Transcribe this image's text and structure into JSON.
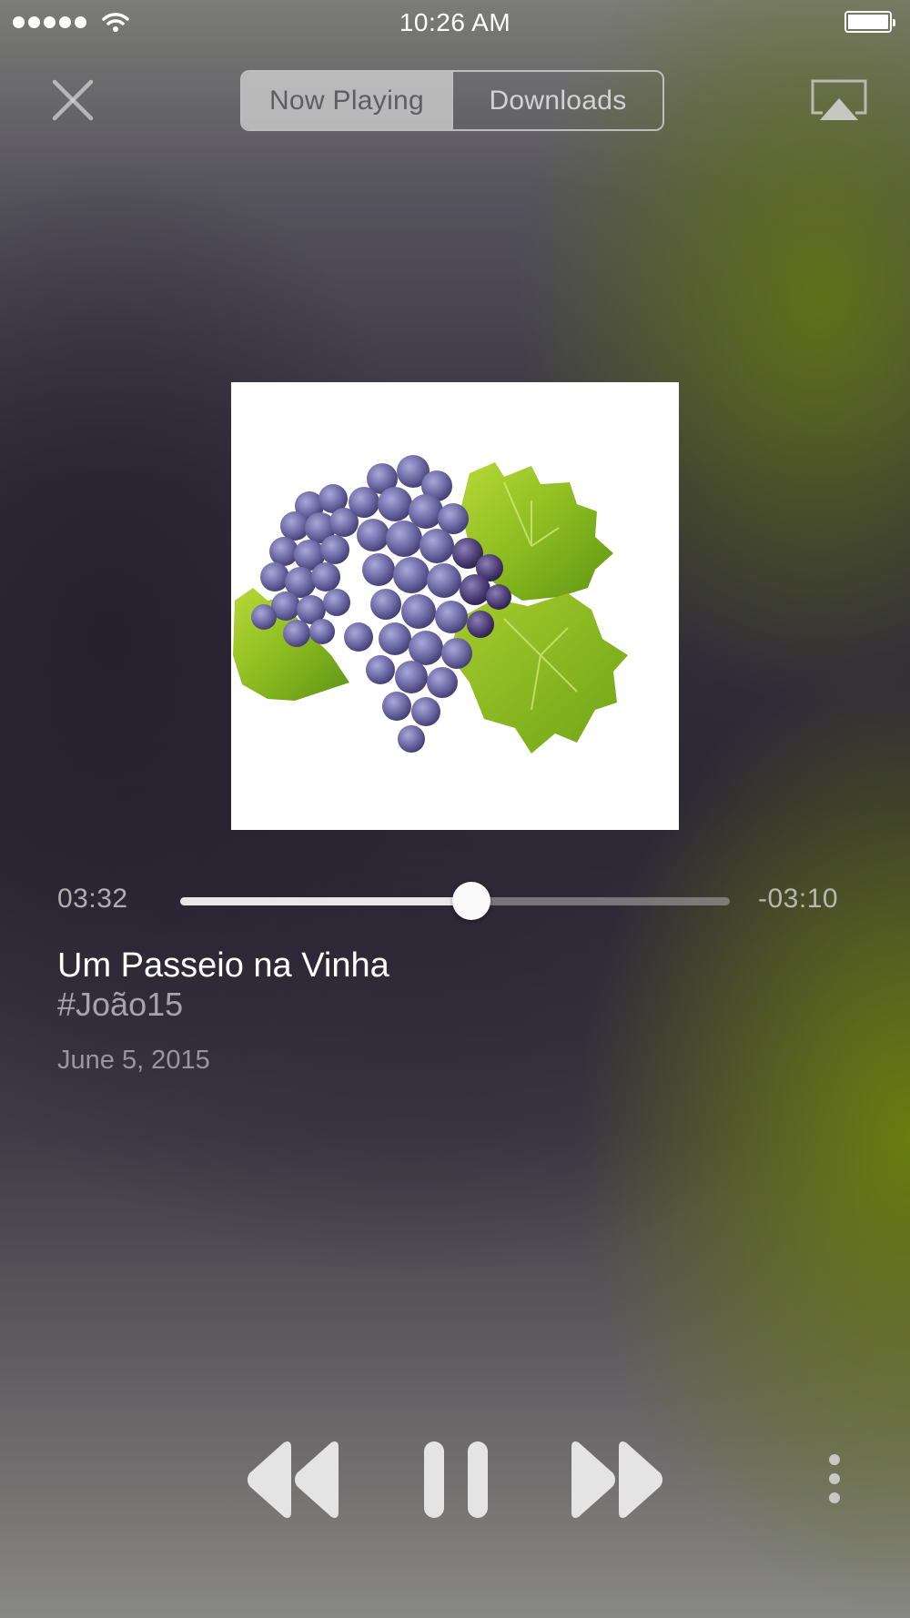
{
  "status_bar": {
    "time": "10:26 AM",
    "signal_icon": "cellular-signal-dots-icon",
    "wifi_icon": "wifi-icon",
    "battery_icon": "battery-full-icon"
  },
  "toolbar": {
    "close_icon": "close-icon",
    "tabs": [
      {
        "label": "Now Playing",
        "selected": true
      },
      {
        "label": "Downloads",
        "selected": false
      }
    ],
    "airplay_icon": "airplay-icon"
  },
  "artwork": {
    "icon": "grapes-on-vine-leaves-artwork"
  },
  "playback": {
    "elapsed": "03:32",
    "remaining": "-03:10",
    "progress_fraction": 0.53
  },
  "track": {
    "title": "Um Passeio na Vinha",
    "artist": "#João15",
    "date": "June 5, 2015"
  },
  "controls": {
    "rewind_icon": "rewind-icon",
    "pause_icon": "pause-icon",
    "forward_icon": "fast-forward-icon",
    "more_icon": "more-vertical-icon"
  },
  "colors": {
    "accent_green": "#6c800c",
    "control_fill": "#e4e4e4",
    "segment_active_bg": "#c8c8c8"
  }
}
